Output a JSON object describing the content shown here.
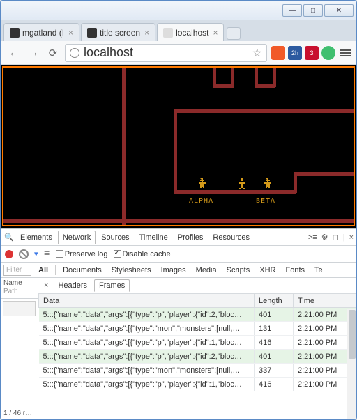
{
  "window": {
    "min_label": "—",
    "max_label": "□",
    "close_label": "✕"
  },
  "tabs": [
    {
      "favicon": "github",
      "title": "mgatland (I",
      "active": false
    },
    {
      "favicon": "github",
      "title": "title screen",
      "active": false
    },
    {
      "favicon": "blank",
      "title": "localhost",
      "active": true
    }
  ],
  "urlbar": {
    "back": "←",
    "fwd": "→",
    "reload": "⟳",
    "url": "localhost",
    "star": "☆"
  },
  "extensions": [
    {
      "name": "postman",
      "badge": "",
      "bg": "#f15a29"
    },
    {
      "name": "rescuetime",
      "badge": "2h",
      "bg": "#2c5aa0"
    },
    {
      "name": "lastpass",
      "badge": "3",
      "bg": "#c8102e"
    },
    {
      "name": "dot",
      "badge": "",
      "bg": "#3fbf6f"
    }
  ],
  "game": {
    "labels": {
      "left": "ALPHA",
      "right": "BETA"
    }
  },
  "devtools": {
    "tabs": [
      "Elements",
      "Network",
      "Sources",
      "Timeline",
      "Profiles",
      "Resources"
    ],
    "active_tab": "Network",
    "drawer_glyph": ">≡",
    "gear_glyph": "⚙",
    "square_glyph": "◻",
    "close_glyph": "×",
    "preserve_log": {
      "label": "Preserve log",
      "checked": false
    },
    "disable_cache": {
      "label": "Disable cache",
      "checked": true
    },
    "filter_placeholder": "Filter",
    "filter_cats": [
      "All",
      "Documents",
      "Stylesheets",
      "Images",
      "Media",
      "Scripts",
      "XHR",
      "Fonts",
      "Te"
    ],
    "side_header": {
      "line1": "Name",
      "line2": "Path"
    },
    "footer": "1 / 46 r…",
    "subtabs": {
      "headers": "Headers",
      "frames": "Frames",
      "active": "Frames"
    },
    "columns": {
      "data": "Data",
      "length": "Length",
      "time": "Time"
    },
    "rows": [
      {
        "hl": true,
        "data": "5:::{\"name\":\"data\",\"args\":[{\"type\":\"p\",\"player\":{\"id\":2,\"bloc…",
        "length": "401",
        "time": "2:21:00 PM"
      },
      {
        "hl": false,
        "data": "5:::{\"name\":\"data\",\"args\":[{\"type\":\"mon\",\"monsters\":[null,…",
        "length": "131",
        "time": "2:21:00 PM"
      },
      {
        "hl": false,
        "data": "5:::{\"name\":\"data\",\"args\":[{\"type\":\"p\",\"player\":{\"id\":1,\"bloc…",
        "length": "416",
        "time": "2:21:00 PM"
      },
      {
        "hl": true,
        "data": "5:::{\"name\":\"data\",\"args\":[{\"type\":\"p\",\"player\":{\"id\":2,\"bloc…",
        "length": "401",
        "time": "2:21:00 PM"
      },
      {
        "hl": false,
        "data": "5:::{\"name\":\"data\",\"args\":[{\"type\":\"mon\",\"monsters\":[null,…",
        "length": "337",
        "time": "2:21:00 PM"
      },
      {
        "hl": false,
        "data": "5:::{\"name\":\"data\",\"args\":[{\"type\":\"p\",\"player\":{\"id\":1,\"bloc…",
        "length": "416",
        "time": "2:21:00 PM"
      }
    ]
  }
}
